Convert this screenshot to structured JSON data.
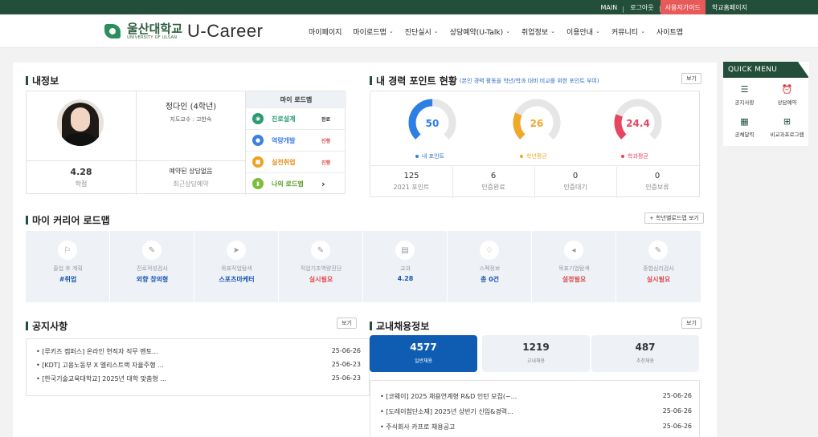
{
  "topbar": {
    "main": "MAIN",
    "logout": "로그아웃",
    "guide": "사용자가이드",
    "homepage": "학교홈페이지"
  },
  "logo": {
    "name_kr": "울산대학교",
    "name_en": "UNIVERSITY OF ULSAN",
    "brand": "U-Career"
  },
  "nav": [
    {
      "label": "마이페이지",
      "chev": ""
    },
    {
      "label": "마이로드맵",
      "chev": "⌄"
    },
    {
      "label": "진단실시",
      "chev": "⌄"
    },
    {
      "label": "상담예약(U-Talk)",
      "chev": "⌄"
    },
    {
      "label": "취업정보",
      "chev": "⌄"
    },
    {
      "label": "이용안내",
      "chev": "⌄"
    },
    {
      "label": "커뮤니티",
      "chev": "⌄"
    },
    {
      "label": "사이트맵",
      "chev": ""
    }
  ],
  "my_info": {
    "title": "내정보",
    "student_name": "정다인 (4학년)",
    "advisor": "지도교수 : 고한숙",
    "gpa_value": "4.28",
    "gpa_label": "학점",
    "consult_value": "예약된 상담없음",
    "consult_label": "최근상담예약",
    "roadmap_title": "마이 로드맵",
    "roadmap": [
      {
        "label": "진로설계",
        "status": "완료",
        "color": "#2a9a6f",
        "label_color": "#2a9a6f",
        "status_color": "#333333",
        "icon": "compass-icon",
        "glyph": "◉"
      },
      {
        "label": "역량개발",
        "status": "진행",
        "color": "#3f7fe0",
        "label_color": "#3f7fe0",
        "status_color": "#e04a4a",
        "icon": "user-icon",
        "glyph": "●"
      },
      {
        "label": "실전취업",
        "status": "진행",
        "color": "#f0a020",
        "label_color": "#e0901a",
        "status_color": "#e04a4a",
        "icon": "briefcase-icon",
        "glyph": "■"
      },
      {
        "label": "나의 로드맵",
        "status": "›",
        "color": "#7bbf3a",
        "label_color": "#5a9e22",
        "status_color": "#333333",
        "icon": "bar-chart-icon",
        "glyph": "▮"
      }
    ]
  },
  "career_points": {
    "title": "내 경력 포인트 현황",
    "subtitle": "(본인 경력 활동을 학년/학과 대비 비교를 위한 포인트 부여)",
    "view_button": "보기",
    "gauges": [
      {
        "value": "50",
        "label": "내 포인트",
        "color": "#2d7fe3",
        "fill": 0.5
      },
      {
        "value": "26",
        "label": "학년평균",
        "color": "#f0a828",
        "fill": 0.26
      },
      {
        "value": "24.4",
        "label": "학과평균",
        "color": "#e84560",
        "fill": 0.244
      }
    ],
    "stats": [
      {
        "value": "125",
        "label": "2021 포인트"
      },
      {
        "value": "6",
        "label": "인증완료"
      },
      {
        "value": "0",
        "label": "인증대기"
      },
      {
        "value": "0",
        "label": "인증보류"
      }
    ]
  },
  "career_roadmap": {
    "title": "마이 커리어 로드맵",
    "button": "+ 학년별로드맵 보기",
    "cells": [
      {
        "label": "졸업 후 계획",
        "value": "#취업",
        "color": "#1a56b0",
        "icon": "flag-icon",
        "glyph": "⚐"
      },
      {
        "label": "진로적성검사",
        "value": "외향 창의형",
        "color": "#1a56b0",
        "icon": "pencil-icon",
        "glyph": "✎"
      },
      {
        "label": "목표직업탐색",
        "value": "스포츠마케터",
        "color": "#1a56b0",
        "icon": "cursor-icon",
        "glyph": "➤"
      },
      {
        "label": "직업기초역량진단",
        "value": "실시필요",
        "color": "#e04a4a",
        "icon": "pencil-icon",
        "glyph": "✎"
      },
      {
        "label": "교과",
        "value": "4.28",
        "color": "#1a56b0",
        "icon": "book-icon",
        "glyph": "▤"
      },
      {
        "label": "스펙정보",
        "value": "총 0건",
        "color": "#1a56b0",
        "icon": "badge-icon",
        "glyph": "♢"
      },
      {
        "label": "목표기업탐색",
        "value": "설정필요",
        "color": "#e04a4a",
        "icon": "megaphone-icon",
        "glyph": "◂"
      },
      {
        "label": "종합심리검사",
        "value": "실시필요",
        "color": "#e04a4a",
        "icon": "pencil-icon",
        "glyph": "✎"
      }
    ]
  },
  "notices": {
    "title": "공지사항",
    "view_button": "보기",
    "items": [
      {
        "title": "• [루키즈 캠퍼스] 온라인 현직자 직무 멘토...",
        "date": "25-06-26"
      },
      {
        "title": "• [KDT] 고용노동부 X 엘리스트랙 자율주행 ...",
        "date": "25-06-23"
      },
      {
        "title": "• [한국기술교육대학교] 2025년 대학 맞춤형 ...",
        "date": "25-06-23"
      }
    ]
  },
  "jobs": {
    "title": "교내채용정보",
    "view_button": "보기",
    "tabs": [
      {
        "value": "4577",
        "label": "일반채용"
      },
      {
        "value": "1219",
        "label": "교내채용"
      },
      {
        "value": "487",
        "label": "추천채용"
      }
    ],
    "items": [
      {
        "title": "• [코웨이] 2025 채용연계형 R&D 인턴 모집(~...",
        "date": "25-06-26"
      },
      {
        "title": "• [도레이첨단소재] 2025년 상반기 신입&경력...",
        "date": "25-06-26"
      },
      {
        "title": "• 주식회사 카프로 채용공고",
        "date": "25-06-26"
      }
    ]
  },
  "quick_menu": {
    "title": "QUICK MENU",
    "items": [
      {
        "label": "공지사항",
        "icon": "list-icon",
        "glyph": "☰"
      },
      {
        "label": "상담예약",
        "icon": "alarm-clock-icon",
        "glyph": "⏰"
      },
      {
        "label": "공채달력",
        "icon": "calendar-icon",
        "glyph": "▦"
      },
      {
        "label": "비교과프로그램",
        "icon": "add-calendar-icon",
        "glyph": "⊞"
      }
    ]
  }
}
